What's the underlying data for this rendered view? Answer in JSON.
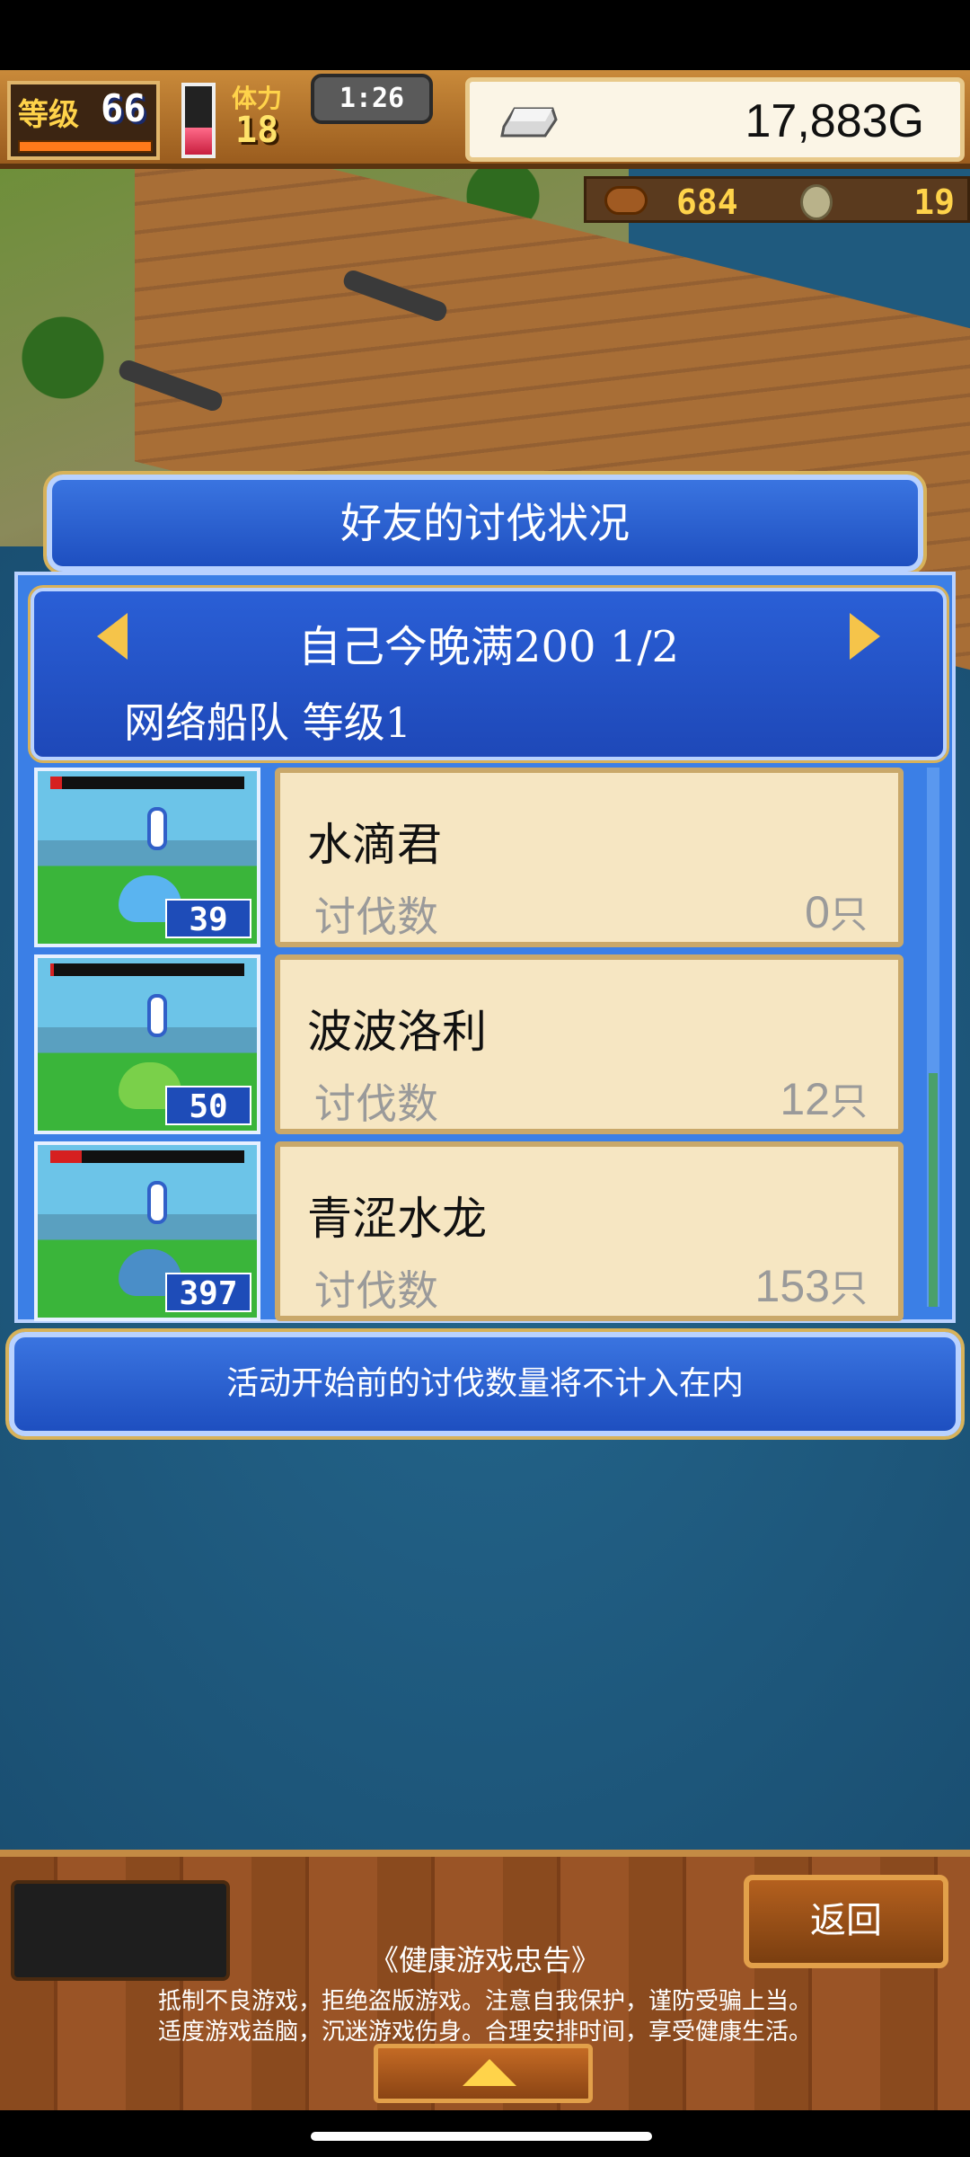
{
  "hud": {
    "level_label": "等级",
    "level_value": "66",
    "stamina_label": "体力",
    "stamina_value": "18",
    "timer": "1:26",
    "gold": "17,883G",
    "meat_count": "684",
    "medal_count": "19",
    "icons": [
      "silver-ingot-icon",
      "meat-icon",
      "medal-icon"
    ]
  },
  "panel": {
    "title": "好友的讨伐状况",
    "event_name": "自己今晚满200 1/2",
    "fleet_level": "网络船队 等级1",
    "rows": [
      {
        "name": "水滴君",
        "kill_label": "讨伐数",
        "kill_count": "0",
        "unit": "只",
        "level": "39",
        "hp_fraction": 0.06,
        "monster_color": "#5ab4f0"
      },
      {
        "name": "波波洛利",
        "kill_label": "讨伐数",
        "kill_count": "12",
        "unit": "只",
        "level": "50",
        "hp_fraction": 0.02,
        "monster_color": "#7ad04a"
      },
      {
        "name": "青涩水龙",
        "kill_label": "讨伐数",
        "kill_count": "153",
        "unit": "只",
        "level": "397",
        "hp_fraction": 0.16,
        "monster_color": "#4a8ec8"
      }
    ],
    "notice": "活动开始前的讨伐数量将不计入在内"
  },
  "bottom": {
    "back_label": "返回",
    "health_title": "《健康游戏忠告》",
    "health_line1": "抵制不良游戏，拒绝盗版游戏。注意自我保护，谨防受骗上当。",
    "health_line2": "适度游戏益脑，沉迷游戏伤身。合理安排时间，享受健康生活。"
  },
  "colors": {
    "panel_blue": "#3b7fe6",
    "card_bg": "#f6e6c2",
    "gold_text": "#ffd34a"
  }
}
